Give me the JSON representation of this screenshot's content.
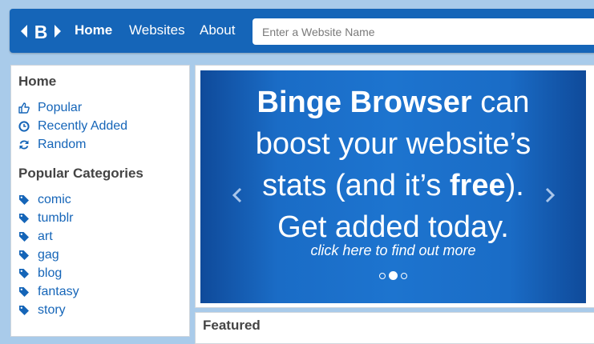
{
  "navbar": {
    "logo_text": "B",
    "links": [
      "Home",
      "Websites",
      "About"
    ],
    "search_placeholder": "Enter a Website Name"
  },
  "sidebar": {
    "home_heading": "Home",
    "home_items": [
      {
        "label": "Popular",
        "icon": "thumbs-up-icon"
      },
      {
        "label": "Recently Added",
        "icon": "clock-icon"
      },
      {
        "label": "Random",
        "icon": "refresh-icon"
      }
    ],
    "categories_heading": "Popular Categories",
    "categories": [
      "comic",
      "tumblr",
      "art",
      "gag",
      "blog",
      "fantasy",
      "story"
    ]
  },
  "carousel": {
    "line1_bold": "Binge Browser",
    "line1_rest": " can",
    "line2": "boost your website’s",
    "line3_pre": "stats (and it’s ",
    "line3_bold": "free",
    "line3_post": ").",
    "line4": "Get added today.",
    "cta": "click here to find out more",
    "slides": 3,
    "active_slide": 2
  },
  "featured": {
    "title": "Featured"
  },
  "colors": {
    "brand": "#1565b8",
    "page_bg": "#a9cbea"
  }
}
